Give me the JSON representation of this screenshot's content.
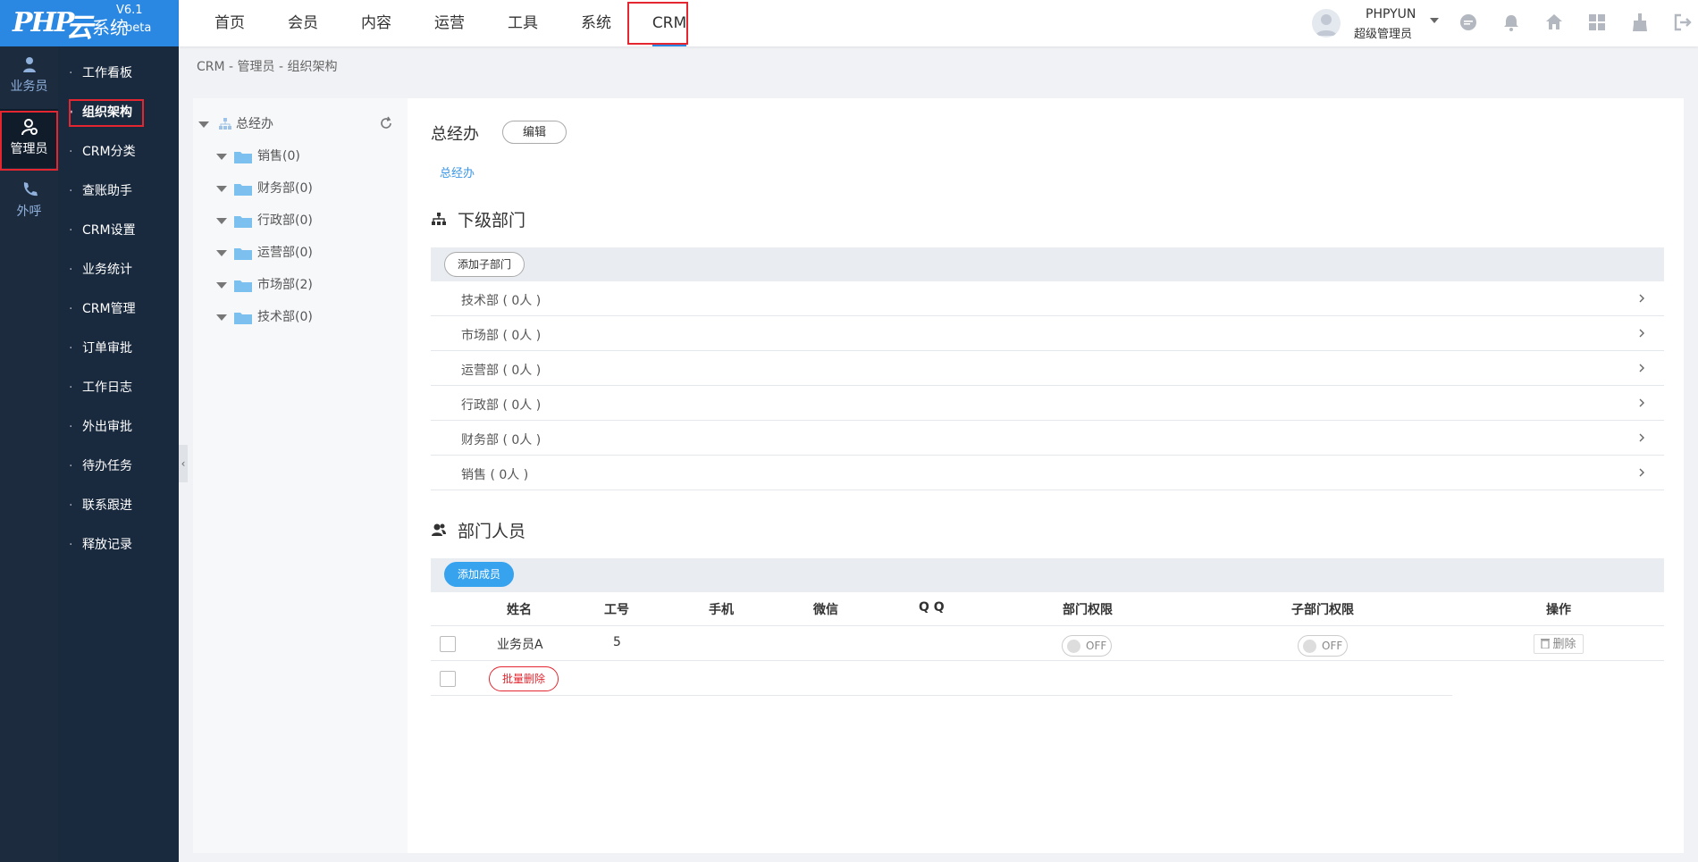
{
  "logo": {
    "php": "PHP",
    "cloud": "云",
    "sys": "系统",
    "version": "V6.1",
    "beta": "beta"
  },
  "topnav": {
    "items": [
      "首页",
      "会员",
      "内容",
      "运营",
      "工具",
      "系统",
      "CRM"
    ],
    "active": "CRM"
  },
  "user": {
    "name": "PHPYUN",
    "role": "超级管理员"
  },
  "top_icons": [
    "chat-icon",
    "bell-icon",
    "home-icon",
    "apps-icon",
    "broom-icon",
    "logout-icon"
  ],
  "sidebar_main": {
    "items": [
      {
        "label": "业务员",
        "icon": "users-icon"
      },
      {
        "label": "管理员",
        "icon": "admin-icon"
      },
      {
        "label": "外呼",
        "icon": "phone-icon"
      }
    ],
    "active": "管理员"
  },
  "sidebar_sub": {
    "items": [
      "工作看板",
      "组织架构",
      "CRM分类",
      "查账助手",
      "CRM设置",
      "业务统计",
      "CRM管理",
      "订单审批",
      "工作日志",
      "外出审批",
      "待办任务",
      "联系跟进",
      "释放记录"
    ],
    "active": "组织架构"
  },
  "breadcrumb": "CRM - 管理员 - 组织架构",
  "tree": {
    "root": "总经办",
    "children": [
      "销售(0)",
      "财务部(0)",
      "行政部(0)",
      "运营部(0)",
      "市场部(2)",
      "技术部(0)"
    ]
  },
  "dept": {
    "title": "总经办",
    "edit_label": "编辑",
    "link": "总经办"
  },
  "sub_depts": {
    "title": "下级部门",
    "add_label": "添加子部门",
    "items": [
      "技术部 ( 0人 )",
      "市场部 ( 0人 )",
      "运营部 ( 0人 )",
      "行政部 ( 0人 )",
      "财务部 ( 0人 )",
      "销售 ( 0人 )"
    ]
  },
  "members": {
    "title": "部门人员",
    "add_label": "添加成员",
    "columns": [
      "姓名",
      "工号",
      "手机",
      "微信",
      "Q Q",
      "部门权限",
      "子部门权限",
      "操作"
    ],
    "rows": [
      {
        "name": "业务员A",
        "id": "5",
        "phone": "",
        "wechat": "",
        "qq": "",
        "dept_perm": "OFF",
        "sub_perm": "OFF",
        "action": "删除"
      }
    ],
    "batch_delete": "批量删除"
  },
  "colors": {
    "brand": "#2a88e3",
    "sidebar": "#1d2b3e",
    "highlight": "#e3262f",
    "accent_blue": "#37a3ef"
  }
}
